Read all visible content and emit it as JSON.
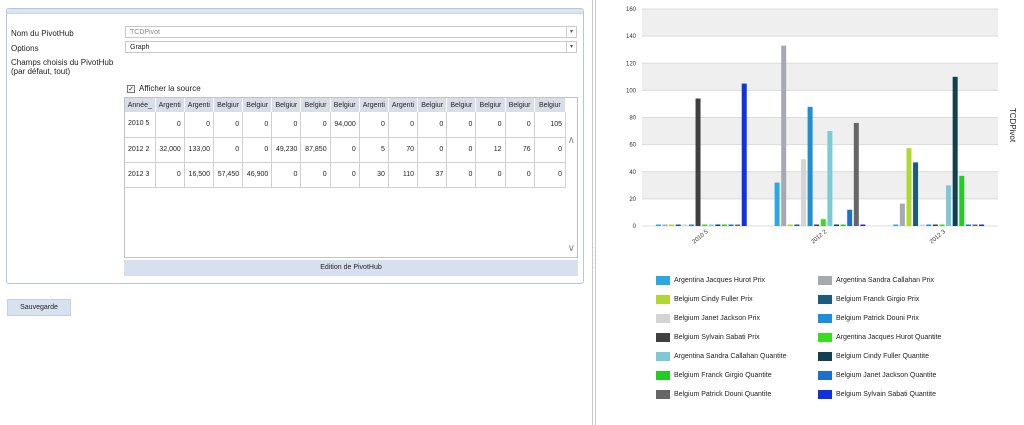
{
  "form": {
    "pivothub_name_label": "Nom du PivotHub",
    "pivothub_name_value": "TCDPivot",
    "options_label": "Options",
    "options_value": "Graph",
    "fields_label_line1": "Champs choisis du PivotHub",
    "fields_label_line2": "(par défaut, tout)",
    "show_source_label": "Afficher la source",
    "show_source_checked": true,
    "edit_button": "Edition de PivotHub",
    "save_button": "Sauvegarde"
  },
  "grid": {
    "headers": [
      "Année_",
      "Argenti",
      "Argenti",
      "Belgiur",
      "Belgiur",
      "Belgiur",
      "Belgiur",
      "Belgiur",
      "Argenti",
      "Argenti",
      "Belgiur",
      "Belgiur",
      "Belgiur",
      "Belgiur",
      "Belgiur"
    ],
    "rows": [
      [
        "2010 5",
        "0",
        "0",
        "0",
        "0",
        "0",
        "0",
        "94,000",
        "0",
        "0",
        "0",
        "0",
        "0",
        "0",
        "105"
      ],
      [
        "2012 2",
        "32,000",
        "133,00",
        "0",
        "0",
        "49,230",
        "87,850",
        "0",
        "5",
        "70",
        "0",
        "0",
        "12",
        "76",
        "0"
      ],
      [
        "2012 3",
        "0",
        "16,500",
        "57,450",
        "46,900",
        "0",
        "0",
        "0",
        "30",
        "110",
        "37",
        "0",
        "0",
        "0",
        "0"
      ]
    ]
  },
  "chart_data": {
    "type": "bar",
    "ylabel": "TCDPivot",
    "ylim": [
      0,
      160
    ],
    "yticks": [
      0,
      20,
      40,
      60,
      80,
      100,
      120,
      140,
      160
    ],
    "categories": [
      "2010 5",
      "2012 2",
      "2012 3"
    ],
    "grid": true,
    "legend_position": "bottom",
    "series": [
      {
        "name": "Argentina Jacques Hurot Prix",
        "color": "#29a9e1",
        "values": [
          0,
          32,
          0
        ]
      },
      {
        "name": "Argentina Sandra Callahan Prix",
        "color": "#a6a9ad",
        "values": [
          0,
          133,
          16.5
        ]
      },
      {
        "name": "Belgium Cindy Fuller Prix",
        "color": "#b1d832",
        "values": [
          0,
          0,
          57.45
        ]
      },
      {
        "name": "Belgium Franck Girgio Prix",
        "color": "#1a5c7a",
        "values": [
          0,
          0,
          46.9
        ]
      },
      {
        "name": "Belgium Janet Jackson Prix",
        "color": "#d4d4d4",
        "values": [
          0,
          49.23,
          0
        ]
      },
      {
        "name": "Belgium Patrick Douni Prix",
        "color": "#1e8fd6",
        "values": [
          0,
          87.85,
          0
        ]
      },
      {
        "name": "Belgium Sylvain Sabati Prix",
        "color": "#404040",
        "values": [
          94,
          0,
          0
        ]
      },
      {
        "name": "Argentina Jacques Hurot Quantite",
        "color": "#3adc22",
        "values": [
          0,
          5,
          0
        ]
      },
      {
        "name": "Argentina Sandra Callahan Quantite",
        "color": "#7cc9d8",
        "values": [
          0,
          70,
          30
        ]
      },
      {
        "name": "Belgium Cindy Fuller Quantite",
        "color": "#0f4150",
        "values": [
          0,
          0,
          110
        ]
      },
      {
        "name": "Belgium Franck Girgio Quantite",
        "color": "#22cc22",
        "values": [
          0,
          0,
          37
        ]
      },
      {
        "name": "Belgium Janet Jackson Quantite",
        "color": "#1f70c8",
        "values": [
          0,
          12,
          0
        ]
      },
      {
        "name": "Belgium Patrick Douni Quantite",
        "color": "#666666",
        "values": [
          0,
          76,
          0
        ]
      },
      {
        "name": "Belgium Sylvain Sabati Quantite",
        "color": "#1133dd",
        "values": [
          105,
          0,
          0
        ]
      }
    ]
  }
}
